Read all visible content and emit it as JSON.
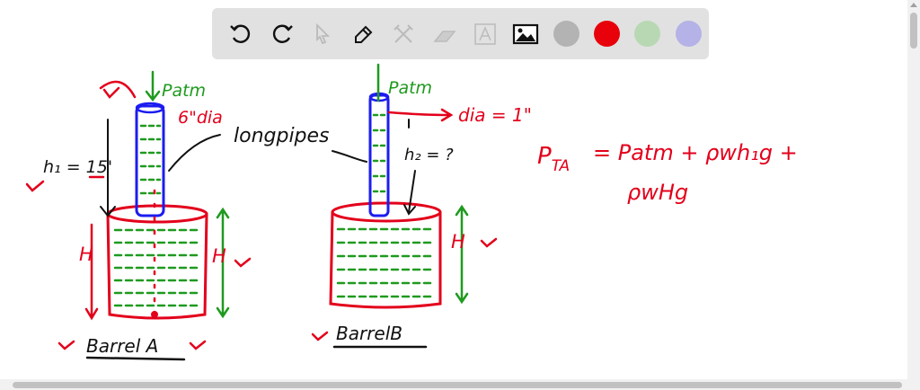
{
  "toolbar": {
    "tools": [
      "undo-icon",
      "redo-icon",
      "select-icon",
      "pen-icon",
      "tools-icon",
      "eraser-icon",
      "text-icon",
      "image-icon"
    ],
    "colors": [
      "#b3b3b3",
      "#e8000b",
      "#b8d8b4",
      "#b4b2e6"
    ]
  },
  "diagram": {
    "barrel_a": {
      "patm": "Patm",
      "dia": "6\"dia",
      "h1": "h₁ = 15'",
      "tick": "'",
      "H_left": "H",
      "H_right": "H",
      "label": "Barrel A"
    },
    "long_pipes": "longpipes",
    "barrel_b": {
      "patm": "Patm",
      "dia": "dia = 1\"",
      "h2": "h₂ = ?",
      "H": "H",
      "label": "BarrelB"
    },
    "equation": {
      "line1_lhs": "P",
      "line1_sub": "TA",
      "line1_rhs": "= Patm + ρwh₁g +",
      "line2": "ρwHg"
    },
    "ink_colors": {
      "red": "#e3001b",
      "green": "#1f9a1f",
      "blue": "#1c1cf0",
      "black": "#111111"
    }
  }
}
